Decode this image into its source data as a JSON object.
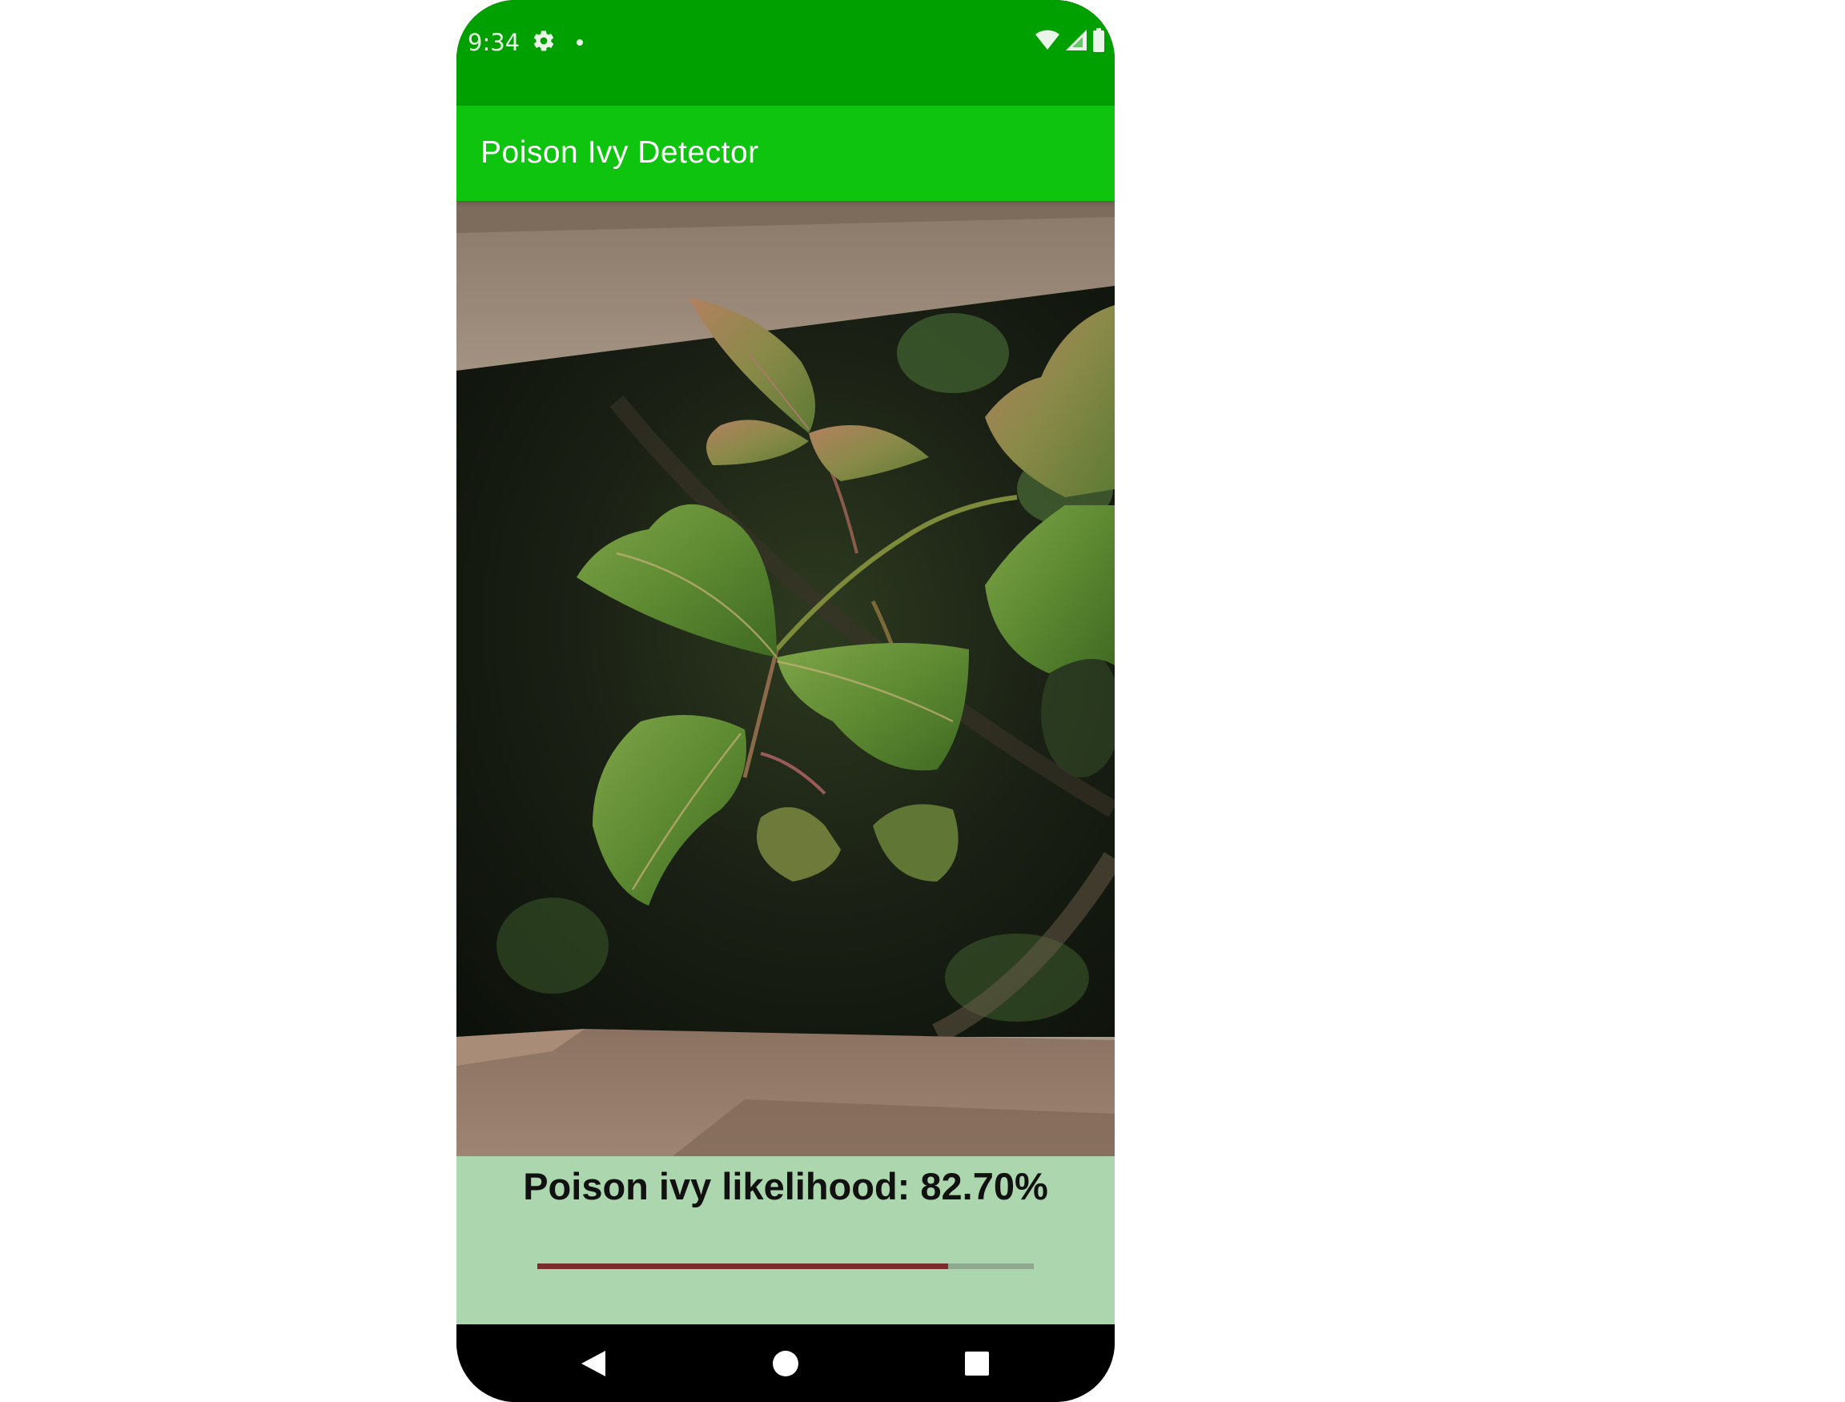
{
  "status_bar": {
    "time": "9:34",
    "icons": [
      "gear-icon",
      "notification-dot",
      "wifi-icon",
      "cellular-signal-icon",
      "battery-icon"
    ],
    "background_color": "#00a000"
  },
  "app_bar": {
    "title": "Poison Ivy Detector",
    "background_color": "#0ec40e"
  },
  "image": {
    "subject": "poison ivy leaves photo"
  },
  "result": {
    "text": "Poison ivy likelihood: 82.70%",
    "likelihood_percent": 82.7,
    "panel_color": "#acd6ae",
    "bar_fill_color": "#7a2b2b",
    "bar_track_color": "#8fa890"
  },
  "nav_bar": {
    "buttons": [
      "back-icon",
      "home-icon",
      "recents-icon"
    ]
  }
}
